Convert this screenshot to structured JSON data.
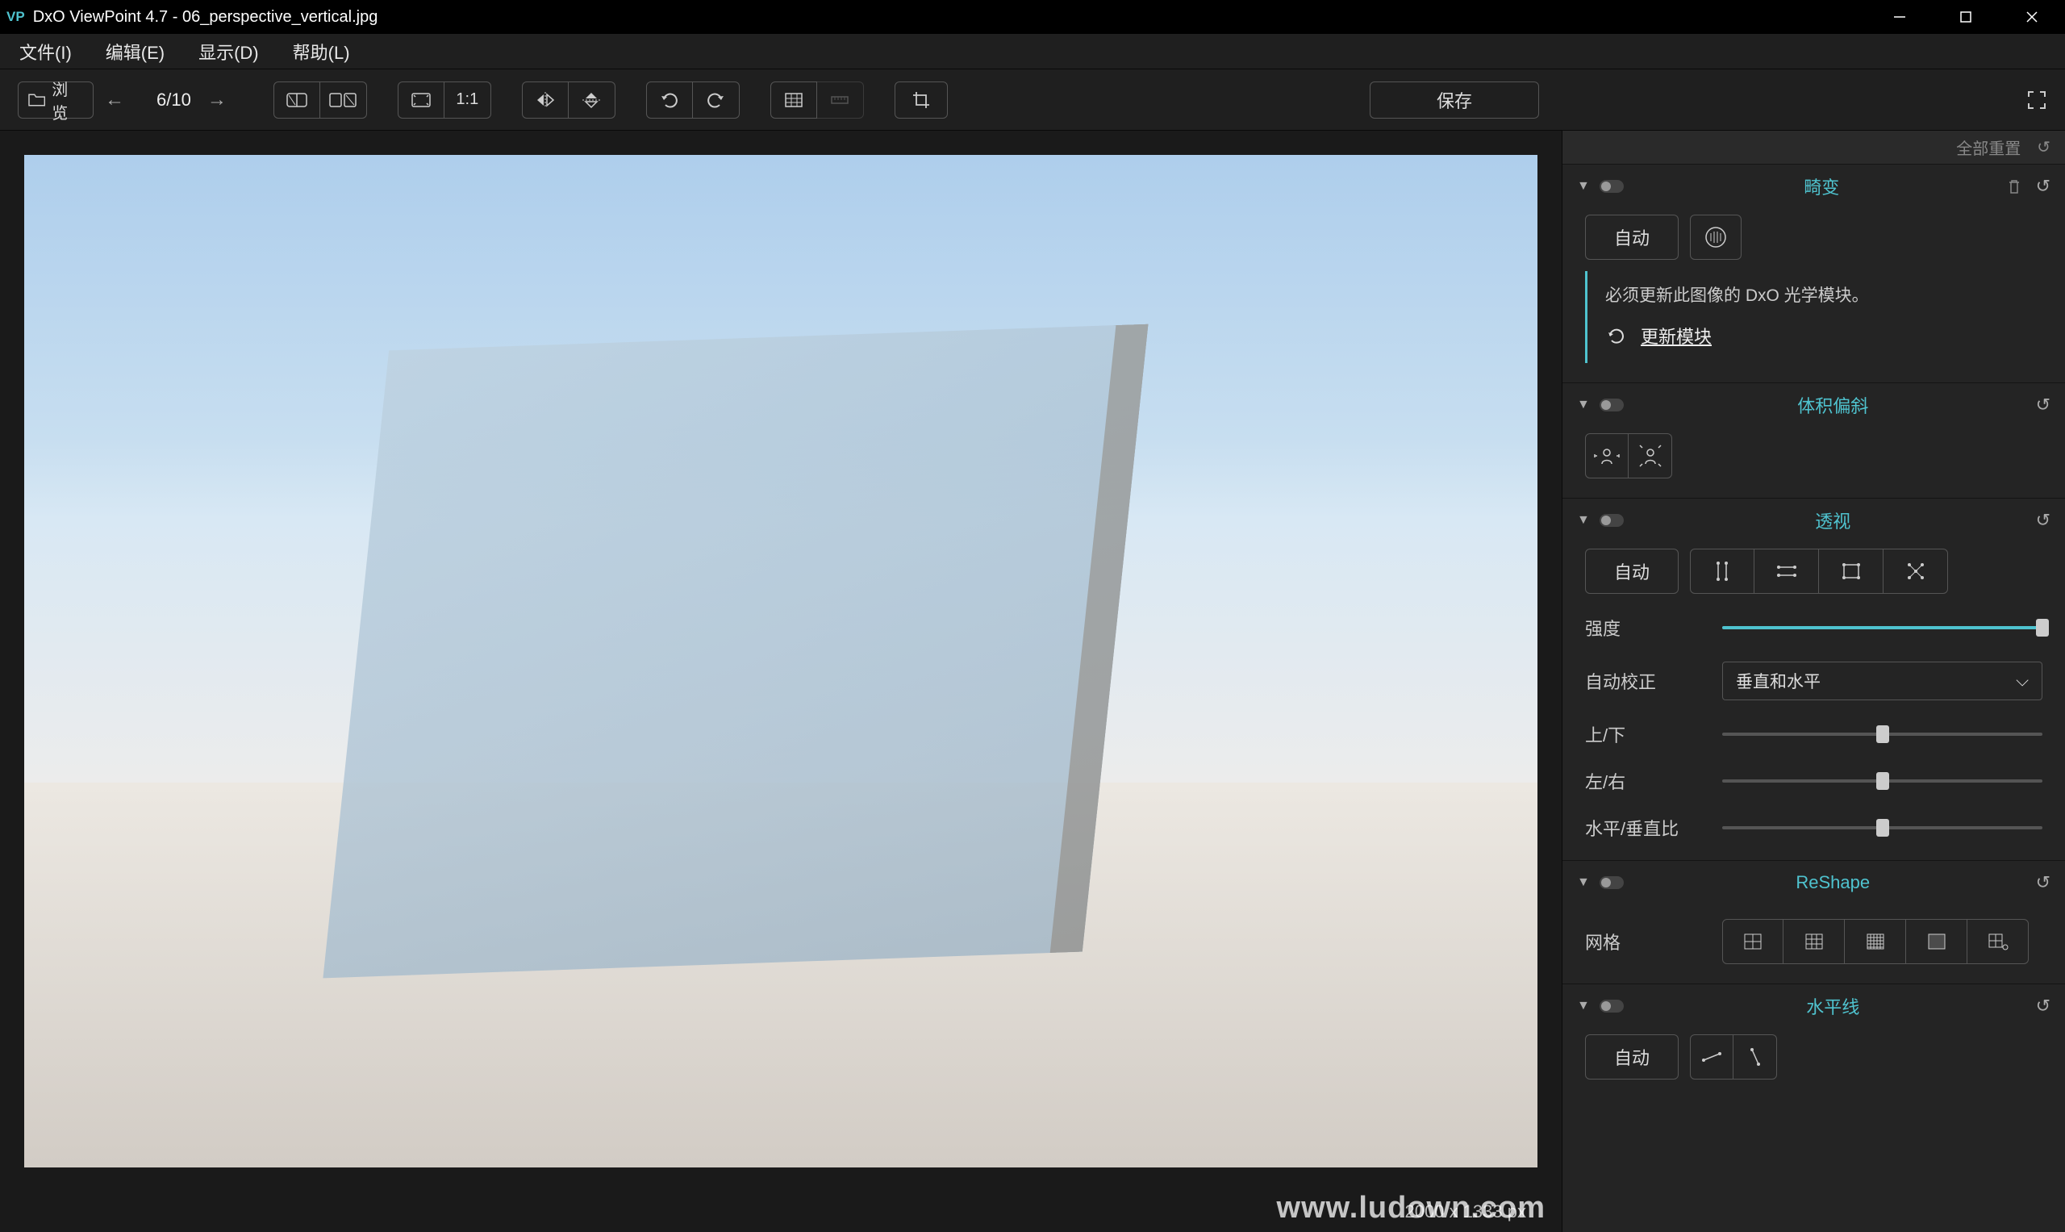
{
  "app": {
    "icon_text": "VP",
    "title": "DxO ViewPoint 4.7 - 06_perspective_vertical.jpg"
  },
  "menu": {
    "file": "文件(I)",
    "edit": "编辑(E)",
    "view": "显示(D)",
    "help": "帮助(L)"
  },
  "toolbar": {
    "browse": "浏览",
    "counter": "6/10",
    "one_to_one": "1:1",
    "save": "保存"
  },
  "status": {
    "dimensions": "2000 x 1333 px"
  },
  "panel": {
    "reset_all": "全部重置",
    "distortion": {
      "title": "畸变",
      "auto": "自动",
      "message": "必须更新此图像的 DxO 光学模块。",
      "update": "更新模块"
    },
    "volume": {
      "title": "体积偏斜"
    },
    "perspective": {
      "title": "透视",
      "auto": "自动",
      "intensity": "强度",
      "autocorrect": "自动校正",
      "autocorrect_value": "垂直和水平",
      "updown": "上/下",
      "leftright": "左/右",
      "hvratio": "水平/垂直比"
    },
    "reshape": {
      "title": "ReShape",
      "grid": "网格"
    },
    "horizon": {
      "title": "水平线",
      "auto": "自动"
    }
  },
  "watermark": "www.ludown.com"
}
